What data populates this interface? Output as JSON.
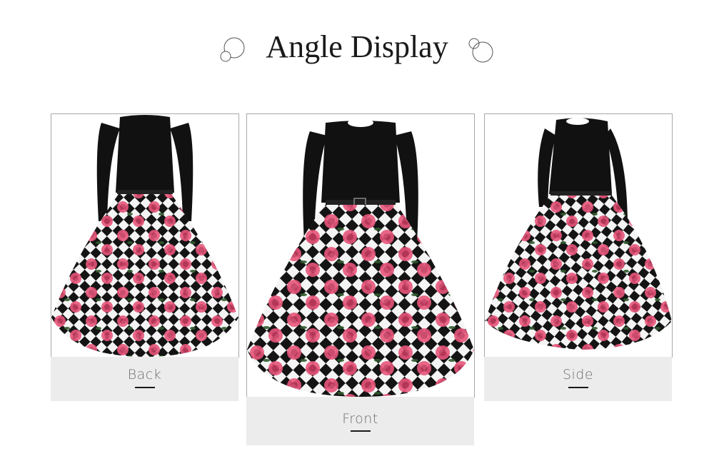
{
  "heading": {
    "title": "Angle Display"
  },
  "views": [
    {
      "label": "Back"
    },
    {
      "label": "Front"
    },
    {
      "label": "Side"
    }
  ],
  "colors": {
    "bodice": "#111111",
    "check_dark": "#141414",
    "check_light": "#f4f4f4",
    "rose": "#e8557a",
    "rose_dark": "#c53a5e",
    "leaf": "#2f5a2c",
    "label_bg": "#ececec"
  },
  "icons": [
    "bubble-decoration-icon",
    "bubble-decoration-icon"
  ]
}
